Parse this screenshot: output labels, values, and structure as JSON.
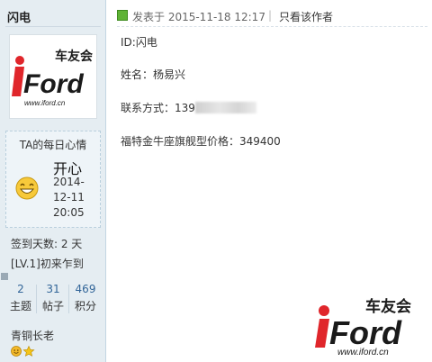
{
  "user": {
    "name": "闪电",
    "mood_title": "TA的每日心情",
    "mood_value": "开心",
    "mood_date_lines": [
      "2014-",
      "12-11",
      "20:05"
    ],
    "sign_days": "签到天数: 2 天",
    "level": "[LV.1]初来乍到",
    "stats": [
      {
        "num": "2",
        "label": "主题"
      },
      {
        "num": "31",
        "label": "帖子"
      },
      {
        "num": "469",
        "label": "积分"
      }
    ],
    "rank": "青铜长老"
  },
  "avatar": {
    "brand_text": "车友会",
    "logo_text": "iFord",
    "url_text": "www.iford.cn"
  },
  "post": {
    "date": "发表于 2015-11-18 12:17",
    "divider": "|",
    "author_only": "只看该作者",
    "lines": {
      "id": "ID:闪电",
      "name": "姓名：杨易兴",
      "contact_label": "联系方式：139",
      "price": "福特金牛座旗舰型价格：349400"
    }
  },
  "watermark": {
    "brand_text": "车友会",
    "logo_text": "iFord",
    "url_text": "www.iford.cn"
  },
  "colors": {
    "sidebar_bg": "#e5edf2",
    "logo_red": "#e0262b",
    "logo_dark": "#1a1a1a",
    "post_icon": "#5fb336",
    "stat_link": "#336699"
  }
}
